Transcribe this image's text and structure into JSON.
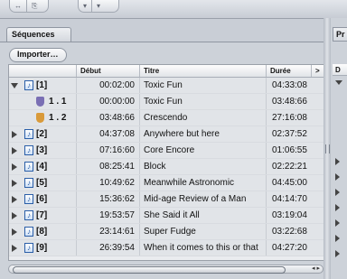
{
  "toolbar": {
    "group1": [
      "↔",
      "⎘"
    ],
    "group2": [
      "▾",
      "▾"
    ]
  },
  "tab": {
    "label": "Séquences"
  },
  "right_tab": {
    "label": "Pr"
  },
  "right_header": {
    "label": "D"
  },
  "import_button": {
    "label": "Importer…"
  },
  "columns": {
    "debut": "Début",
    "titre": "Titre",
    "duree": "Durée",
    "more": ">"
  },
  "rows": [
    {
      "kind": "seq",
      "expanded": true,
      "label": "[1]",
      "debut": "00:02:00",
      "titre": "Toxic Fun",
      "duree": "04:33:08"
    },
    {
      "kind": "sub",
      "shield": "purple",
      "label": "1 . 1",
      "debut": "00:00:00",
      "titre": "Toxic Fun",
      "duree": "03:48:66"
    },
    {
      "kind": "sub",
      "shield": "orange",
      "label": "1 . 2",
      "debut": "03:48:66",
      "titre": "Crescendo",
      "duree": "27:16:08"
    },
    {
      "kind": "seq",
      "label": "[2]",
      "debut": "04:37:08",
      "titre": "Anywhere but here",
      "duree": "02:37:52"
    },
    {
      "kind": "seq",
      "label": "[3]",
      "debut": "07:16:60",
      "titre": "Core Encore",
      "duree": "01:06:55"
    },
    {
      "kind": "seq",
      "label": "[4]",
      "debut": "08:25:41",
      "titre": "Block",
      "duree": "02:22:21"
    },
    {
      "kind": "seq",
      "label": "[5]",
      "debut": "10:49:62",
      "titre": "Meanwhile Astronomic",
      "duree": "04:45:00"
    },
    {
      "kind": "seq",
      "label": "[6]",
      "debut": "15:36:62",
      "titre": "Mid-age Review of a Man",
      "duree": "04:14:70"
    },
    {
      "kind": "seq",
      "label": "[7]",
      "debut": "19:53:57",
      "titre": "She Said it All",
      "duree": "03:19:04"
    },
    {
      "kind": "seq",
      "label": "[8]",
      "debut": "23:14:61",
      "titre": "Super Fudge",
      "duree": "03:22:68"
    },
    {
      "kind": "seq",
      "label": "[9]",
      "debut": "26:39:54",
      "titre": "When it comes to this or that",
      "duree": "04:27:20"
    }
  ],
  "scroll": {
    "arrows": "◂ ▸"
  },
  "colors": {
    "shield_purple": "#7a6fb4",
    "shield_orange": "#d99a3a",
    "icon_blue": "#2a5ea8"
  },
  "icons": {
    "sequence": "music-note-icon"
  }
}
